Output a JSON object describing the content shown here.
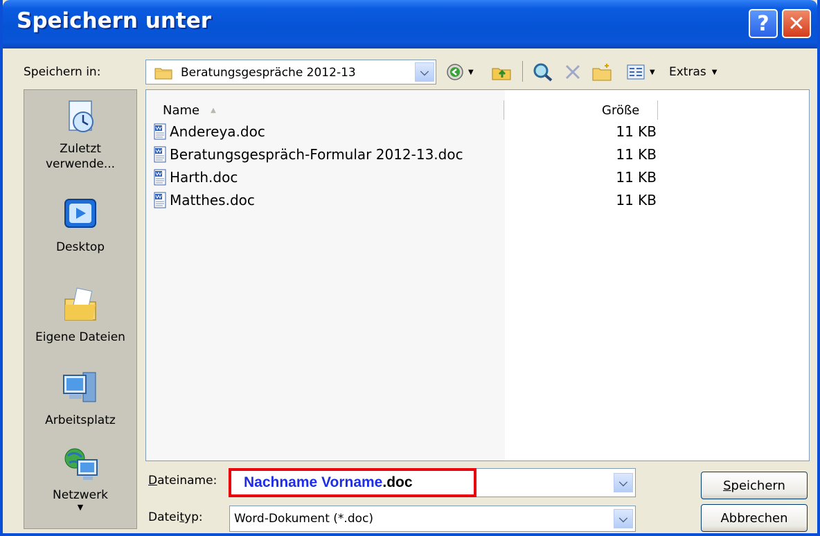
{
  "window": {
    "title": "Speichern unter",
    "help_label": "?",
    "close_label": "✕"
  },
  "toolbar": {
    "save_in_label": "Speichern in:",
    "current_folder": "Beratungsgespräche 2012-13",
    "extras_label": "Extras"
  },
  "places": [
    {
      "label": "Zuletzt verwende...",
      "icon": "recent-documents-icon"
    },
    {
      "label": "Desktop",
      "icon": "desktop-icon"
    },
    {
      "label": "Eigene Dateien",
      "icon": "my-documents-icon"
    },
    {
      "label": "Arbeitsplatz",
      "icon": "my-computer-icon"
    },
    {
      "label": "Netzwerk",
      "icon": "network-icon"
    }
  ],
  "filelist": {
    "columns": {
      "name": "Name",
      "size": "Größe"
    },
    "files": [
      {
        "name": "Andereya.doc",
        "size": "11 KB"
      },
      {
        "name": "Beratungsgespräch-Formular 2012-13.doc",
        "size": "11 KB"
      },
      {
        "name": "Harth.doc",
        "size": "11 KB"
      },
      {
        "name": "Matthes.doc",
        "size": "11 KB"
      }
    ]
  },
  "form": {
    "filename_label": "Dateiname:",
    "filename_name_part": "Nachname Vorname",
    "filename_ext_part": ".doc",
    "filetype_label": "Dateityp:",
    "filetype_value": "Word-Dokument (*.doc)"
  },
  "buttons": {
    "save": "Speichern",
    "cancel": "Abbrechen"
  },
  "colors": {
    "titlebar": "#0653d6",
    "highlight_border": "#e8000b",
    "filename_blue": "#1f2ee6"
  }
}
